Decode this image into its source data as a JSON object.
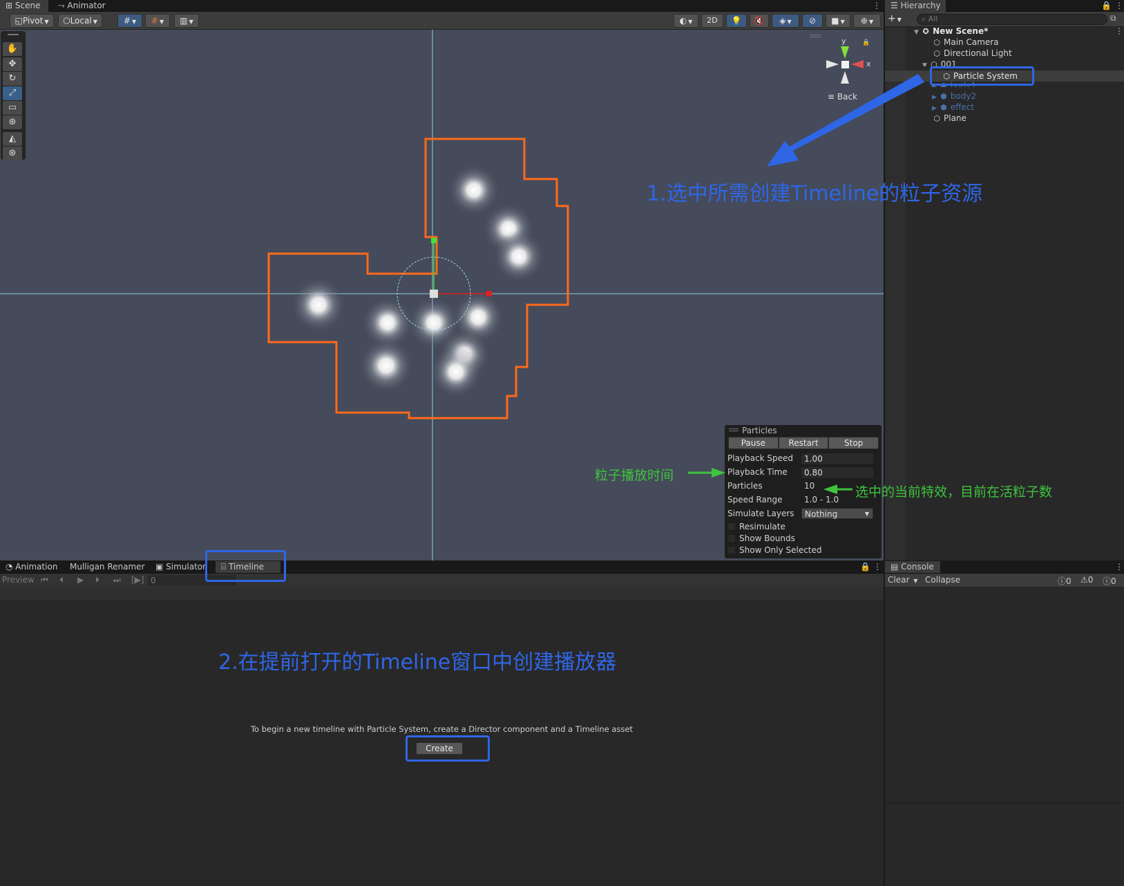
{
  "scene_tabs": [
    {
      "label": "Scene",
      "icon": "grid-icon"
    },
    {
      "label": "Animator",
      "icon": "animator-icon"
    }
  ],
  "scene_toolbar": {
    "pivot": "Pivot",
    "local": "Local",
    "mode_2d": "2D"
  },
  "gizmo": {
    "y": "y",
    "x": "x",
    "view_label": "Back"
  },
  "hierarchy": {
    "tab": "Hierarchy",
    "search_placeholder": "All",
    "items": [
      {
        "label": "New Scene*",
        "depth": 0,
        "bold": true
      },
      {
        "label": "Main Camera",
        "depth": 1
      },
      {
        "label": "Directional Light",
        "depth": 1
      },
      {
        "label": "001",
        "depth": 1
      },
      {
        "label": "Particle System",
        "depth": 2,
        "selected": true
      },
      {
        "label": "body1",
        "depth": 2,
        "prefab": true
      },
      {
        "label": "body2",
        "depth": 2,
        "prefab": true
      },
      {
        "label": "effect",
        "depth": 2,
        "prefab": true
      },
      {
        "label": "Plane",
        "depth": 1
      }
    ]
  },
  "particles_panel": {
    "title": "Particles",
    "buttons": [
      "Pause",
      "Restart",
      "Stop"
    ],
    "rows": [
      {
        "label": "Playback Speed",
        "value": "1.00"
      },
      {
        "label": "Playback Time",
        "value": "0.80"
      },
      {
        "label": "Particles",
        "value": "10"
      },
      {
        "label": "Speed Range",
        "value": "1.0 - 1.0"
      },
      {
        "label": "Simulate Layers",
        "value": "Nothing"
      }
    ],
    "checkboxes": [
      "Resimulate",
      "Show Bounds",
      "Show Only Selected"
    ]
  },
  "annotations": {
    "step1": "1.选中所需创建Timeline的粒子资源",
    "step2": "2.在提前打开的Timeline窗口中创建播放器",
    "playback_time_note": "粒子播放时间",
    "particles_note": "选中的当前特效，目前在活粒子数",
    "colors": {
      "blue": "#2f66e6",
      "green": "#3ec43e",
      "selection_outline": "#ff6a1a"
    }
  },
  "bottom_tabs": [
    {
      "label": "Animation",
      "icon": "animation-icon"
    },
    {
      "label": "Mulligan Renamer"
    },
    {
      "label": "Simulator",
      "icon": "simulator-icon"
    },
    {
      "label": "Timeline",
      "icon": "timeline-icon"
    }
  ],
  "timeline": {
    "preview": "Preview",
    "frame": "0",
    "message": "To begin a new timeline with Particle System, create a Director component and a Timeline asset",
    "create_label": "Create"
  },
  "console": {
    "tab": "Console",
    "clear": "Clear",
    "collapse": "Collapse",
    "info_count": "0",
    "warn_count": "0",
    "error_count": "0"
  }
}
